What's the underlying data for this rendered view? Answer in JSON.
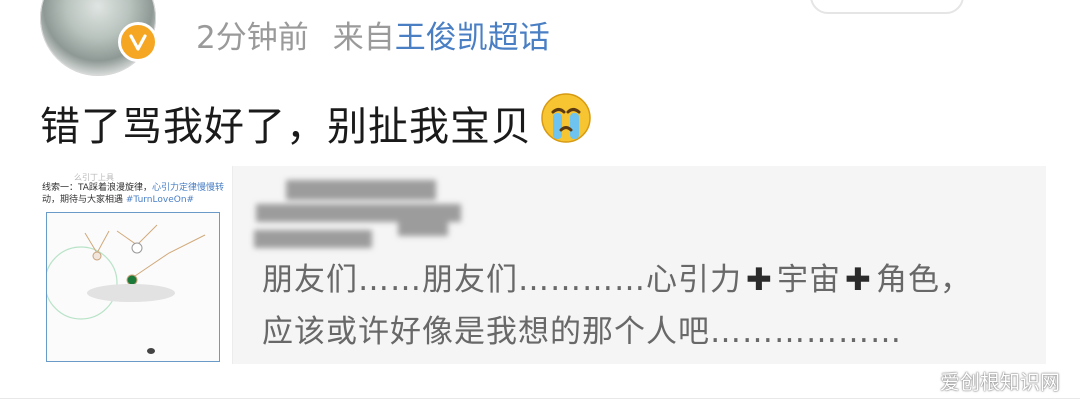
{
  "post": {
    "time_ago": "2分钟前",
    "source_prefix": "来自",
    "source_topic": "王俊凯超话",
    "text": "错了骂我好了，别扯我宝贝",
    "emoji": "crying-face"
  },
  "repost": {
    "thumb_header": "么引丁上具",
    "thumb_text_a": "线索一：TA踩着浪漫旋律，",
    "thumb_text_highlight": "心引力定律慢慢转",
    "thumb_text_b": "动，期待与大家相遇",
    "thumb_hashtag": "#TurnLoveOn#",
    "line1_a": "朋友们……朋友们…………心引力",
    "line1_b": "宇宙",
    "line1_c": "角色，",
    "plus_symbol": "✚",
    "line2": "应该或许好像是我想的那个人吧………………"
  },
  "watermark": "爱创根知识网",
  "colors": {
    "link": "#4a7fc4",
    "meta_gray": "#9a9a9a",
    "verified_badge": "#f5a623",
    "repost_bg": "#f5f5f5"
  }
}
